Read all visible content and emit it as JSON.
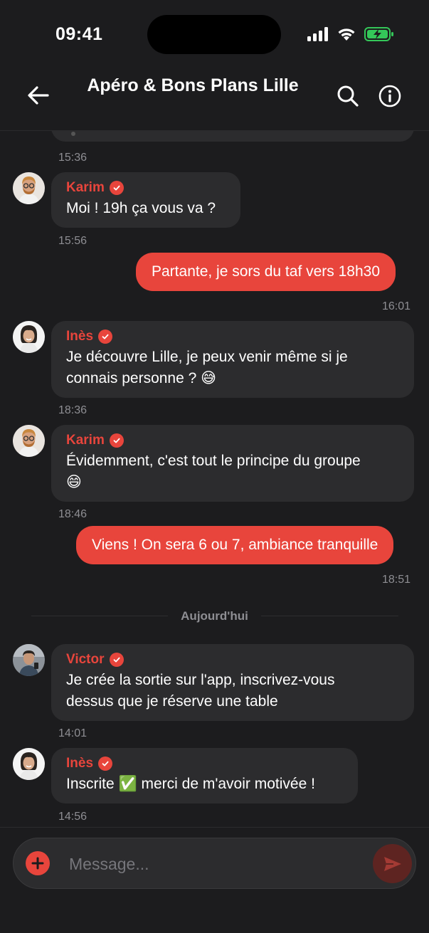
{
  "status_bar": {
    "time": "09:41"
  },
  "header": {
    "title": "Apéro & Bons Plans Lille"
  },
  "messages": [
    {
      "type": "prev",
      "timestamp": "15:36"
    },
    {
      "type": "in",
      "sender": "Karim",
      "text": "Moi ! 19h ça vous va ?",
      "timestamp": "15:56",
      "avatar": "karim"
    },
    {
      "type": "out",
      "text": "Partante, je sors du taf vers 18h30",
      "timestamp": "16:01"
    },
    {
      "type": "in",
      "sender": "Inès",
      "text_lines": [
        "Je découvre Lille, je peux venir même si je",
        "connais personne ? 😅"
      ],
      "timestamp": "18:36",
      "avatar": "ines"
    },
    {
      "type": "in",
      "sender": "Karim",
      "text_lines": [
        "Évidemment, c'est tout le principe du groupe",
        "😄"
      ],
      "timestamp": "18:46",
      "avatar": "karim"
    },
    {
      "type": "out",
      "text": "Viens ! On sera 6 ou 7, ambiance tranquille",
      "timestamp": "18:51"
    },
    {
      "type": "divider",
      "label": "Aujourd'hui"
    },
    {
      "type": "in",
      "sender": "Victor",
      "text_lines": [
        "Je crée la sortie sur l'app, inscrivez-vous",
        "dessus que je réserve une table"
      ],
      "timestamp": "14:01",
      "avatar": "victor"
    },
    {
      "type": "in",
      "sender": "Inès",
      "text": "Inscrite ✅ merci de m'avoir motivée !",
      "timestamp": "14:56",
      "avatar": "ines"
    }
  ],
  "composer": {
    "placeholder": "Message..."
  },
  "icons": {
    "back": "arrow-left-icon",
    "search": "search-icon",
    "info": "info-icon",
    "add": "plus-icon",
    "send": "send-icon",
    "verified": "verified-check-icon"
  },
  "colors": {
    "accent": "#e8453c",
    "background": "#1c1c1e",
    "bubble": "#2c2c2e",
    "muted": "#8e8e93"
  }
}
